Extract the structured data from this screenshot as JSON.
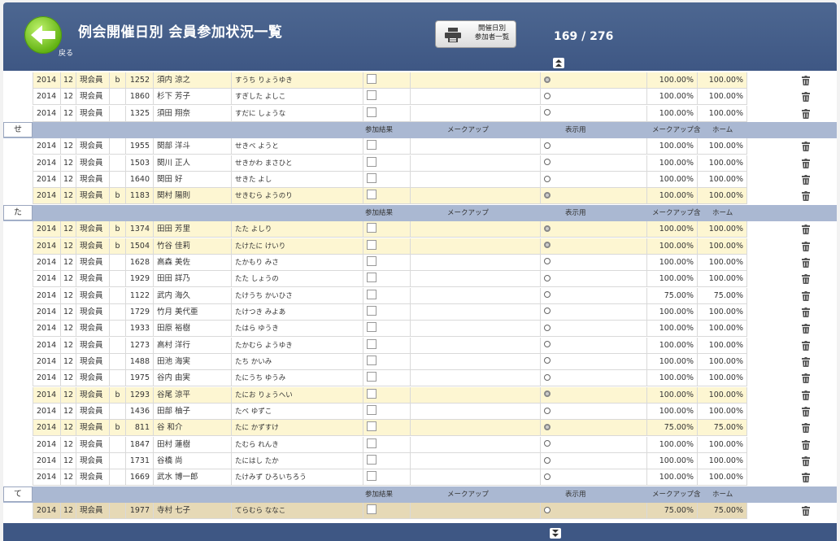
{
  "header": {
    "title": "例会開催日別  会員参加状況一覧",
    "back_label": "戻る",
    "print_label": "開催日別\n参加者一覧",
    "record_counter": "169 / 276"
  },
  "colors": {
    "header": "#3e5784",
    "section": "#aab8d2",
    "highlight": "#fdf6d2",
    "selected": "#e6d9b6",
    "back_button": "#62b213"
  },
  "icons": {
    "back": "back-arrow-icon",
    "print": "printer-icon",
    "delete": "trash-icon",
    "up": "double-chevron-up-icon",
    "down": "double-chevron-down-icon"
  },
  "section_headers": {
    "result": "参加結果",
    "makeup": "メークアップ",
    "display": "表示用",
    "makeup_incl": "メークアップ含",
    "home": "ホーム"
  },
  "groups": [
    {
      "letter": "",
      "rows": [
        {
          "year": "2014",
          "month": "12",
          "type": "現会員",
          "b": "b",
          "num": "1252",
          "name": "須内 涼之",
          "kana": "すうち りょうゆき",
          "display_on": true,
          "pct1": "100.00%",
          "pct2": "100.00%",
          "style": "hl"
        },
        {
          "year": "2014",
          "month": "12",
          "type": "現会員",
          "b": "",
          "num": "1860",
          "name": "杉下 芳子",
          "kana": "すぎした よしこ",
          "display_on": false,
          "pct1": "100.00%",
          "pct2": "100.00%",
          "style": ""
        },
        {
          "year": "2014",
          "month": "12",
          "type": "現会員",
          "b": "",
          "num": "1325",
          "name": "須田 翔奈",
          "kana": "すだに しょうな",
          "display_on": false,
          "pct1": "100.00%",
          "pct2": "100.00%",
          "style": ""
        }
      ]
    },
    {
      "letter": "せ",
      "rows": [
        {
          "year": "2014",
          "month": "12",
          "type": "現会員",
          "b": "",
          "num": "1955",
          "name": "関部 洋斗",
          "kana": "せきべ ようと",
          "display_on": false,
          "pct1": "100.00%",
          "pct2": "100.00%",
          "style": ""
        },
        {
          "year": "2014",
          "month": "12",
          "type": "現会員",
          "b": "",
          "num": "1503",
          "name": "関川 正人",
          "kana": "せきかわ まさひと",
          "display_on": false,
          "pct1": "100.00%",
          "pct2": "100.00%",
          "style": ""
        },
        {
          "year": "2014",
          "month": "12",
          "type": "現会員",
          "b": "",
          "num": "1640",
          "name": "関田 好",
          "kana": "せきた よし",
          "display_on": false,
          "pct1": "100.00%",
          "pct2": "100.00%",
          "style": ""
        },
        {
          "year": "2014",
          "month": "12",
          "type": "現会員",
          "b": "b",
          "num": "1183",
          "name": "関村 陽則",
          "kana": "せきむら ようのり",
          "display_on": true,
          "pct1": "100.00%",
          "pct2": "100.00%",
          "style": "hl"
        }
      ]
    },
    {
      "letter": "た",
      "rows": [
        {
          "year": "2014",
          "month": "12",
          "type": "現会員",
          "b": "b",
          "num": "1374",
          "name": "田田 芳里",
          "kana": "たた よしり",
          "display_on": true,
          "pct1": "100.00%",
          "pct2": "100.00%",
          "style": "hl"
        },
        {
          "year": "2014",
          "month": "12",
          "type": "現会員",
          "b": "b",
          "num": "1504",
          "name": "竹谷 佳莉",
          "kana": "たけたに けいり",
          "display_on": true,
          "pct1": "100.00%",
          "pct2": "100.00%",
          "style": "hl"
        },
        {
          "year": "2014",
          "month": "12",
          "type": "現会員",
          "b": "",
          "num": "1628",
          "name": "高森 美佐",
          "kana": "たかもり みさ",
          "display_on": false,
          "pct1": "100.00%",
          "pct2": "100.00%",
          "style": ""
        },
        {
          "year": "2014",
          "month": "12",
          "type": "現会員",
          "b": "",
          "num": "1929",
          "name": "田田 詳乃",
          "kana": "たた しょうの",
          "display_on": false,
          "pct1": "100.00%",
          "pct2": "100.00%",
          "style": ""
        },
        {
          "year": "2014",
          "month": "12",
          "type": "現会員",
          "b": "",
          "num": "1122",
          "name": "武内 海久",
          "kana": "たけうち かいひさ",
          "display_on": false,
          "pct1": "75.00%",
          "pct2": "75.00%",
          "style": ""
        },
        {
          "year": "2014",
          "month": "12",
          "type": "現会員",
          "b": "",
          "num": "1729",
          "name": "竹月 美代亜",
          "kana": "たけつき みよあ",
          "display_on": false,
          "pct1": "100.00%",
          "pct2": "100.00%",
          "style": ""
        },
        {
          "year": "2014",
          "month": "12",
          "type": "現会員",
          "b": "",
          "num": "1933",
          "name": "田原 裕樹",
          "kana": "たはら ゆうき",
          "display_on": false,
          "pct1": "100.00%",
          "pct2": "100.00%",
          "style": ""
        },
        {
          "year": "2014",
          "month": "12",
          "type": "現会員",
          "b": "",
          "num": "1273",
          "name": "高村 洋行",
          "kana": "たかむら ようゆき",
          "display_on": false,
          "pct1": "100.00%",
          "pct2": "100.00%",
          "style": ""
        },
        {
          "year": "2014",
          "month": "12",
          "type": "現会員",
          "b": "",
          "num": "1488",
          "name": "田池 海実",
          "kana": "たち かいみ",
          "display_on": false,
          "pct1": "100.00%",
          "pct2": "100.00%",
          "style": ""
        },
        {
          "year": "2014",
          "month": "12",
          "type": "現会員",
          "b": "",
          "num": "1975",
          "name": "谷内 由実",
          "kana": "たにうち ゆうみ",
          "display_on": false,
          "pct1": "100.00%",
          "pct2": "100.00%",
          "style": ""
        },
        {
          "year": "2014",
          "month": "12",
          "type": "現会員",
          "b": "b",
          "num": "1293",
          "name": "谷尾 涼平",
          "kana": "たにお りょうへい",
          "display_on": true,
          "pct1": "100.00%",
          "pct2": "100.00%",
          "style": "hl"
        },
        {
          "year": "2014",
          "month": "12",
          "type": "現会員",
          "b": "",
          "num": "1436",
          "name": "田部 柚子",
          "kana": "たべ ゆずこ",
          "display_on": false,
          "pct1": "100.00%",
          "pct2": "100.00%",
          "style": ""
        },
        {
          "year": "2014",
          "month": "12",
          "type": "現会員",
          "b": "b",
          "num": "811",
          "name": "谷 和介",
          "kana": "たに かずすけ",
          "display_on": true,
          "pct1": "75.00%",
          "pct2": "75.00%",
          "style": "hl"
        },
        {
          "year": "2014",
          "month": "12",
          "type": "現会員",
          "b": "",
          "num": "1847",
          "name": "田村 蓮樹",
          "kana": "たむら れんき",
          "display_on": false,
          "pct1": "100.00%",
          "pct2": "100.00%",
          "style": ""
        },
        {
          "year": "2014",
          "month": "12",
          "type": "現会員",
          "b": "",
          "num": "1731",
          "name": "谷橋 尚",
          "kana": "たにはし たか",
          "display_on": false,
          "pct1": "100.00%",
          "pct2": "100.00%",
          "style": ""
        },
        {
          "year": "2014",
          "month": "12",
          "type": "現会員",
          "b": "",
          "num": "1669",
          "name": "武水 博一郎",
          "kana": "たけみず ひろいちろう",
          "display_on": false,
          "pct1": "100.00%",
          "pct2": "100.00%",
          "style": ""
        }
      ]
    },
    {
      "letter": "て",
      "rows": [
        {
          "year": "2014",
          "month": "12",
          "type": "現会員",
          "b": "",
          "num": "1977",
          "name": "寺村 七子",
          "kana": "てらむら ななこ",
          "display_on": false,
          "pct1": "75.00%",
          "pct2": "75.00%",
          "style": "sel"
        }
      ]
    }
  ]
}
